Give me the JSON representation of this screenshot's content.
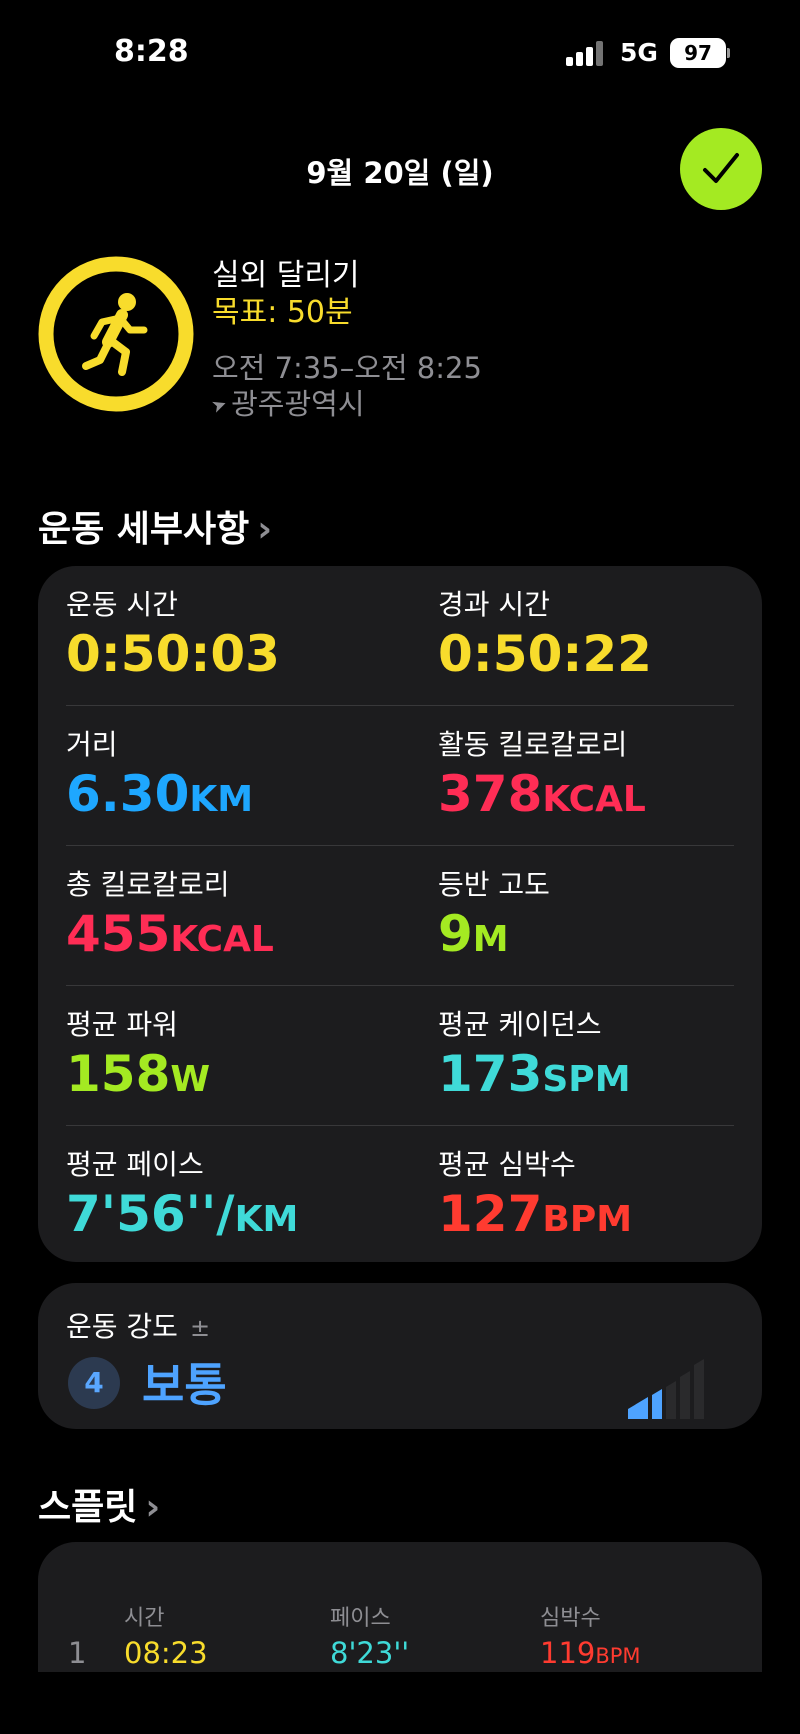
{
  "status_bar": {
    "time": "8:28",
    "network": "5G",
    "battery": "97"
  },
  "header": {
    "date": "9월 20일 (일)"
  },
  "workout": {
    "name": "실외 달리기",
    "goal": "목표: 50분",
    "time_range": "오전 7:35–오전 8:25",
    "location": "광주광역시",
    "icon": "running-figure-icon",
    "ring_color": "#f8dc2c"
  },
  "details": {
    "title": "운동 세부사항",
    "metrics": [
      {
        "label": "운동 시간",
        "value": "0:50:03",
        "unit": "",
        "color": "#f8dc2c"
      },
      {
        "label": "경과 시간",
        "value": "0:50:22",
        "unit": "",
        "color": "#f8dc2c"
      },
      {
        "label": "거리",
        "value": "6.30",
        "unit": "KM",
        "color": "#1ea7ff"
      },
      {
        "label": "활동 킬로칼로리",
        "value": "378",
        "unit": "KCAL",
        "color": "#ff2d55"
      },
      {
        "label": "총 킬로칼로리",
        "value": "455",
        "unit": "KCAL",
        "color": "#ff2d55"
      },
      {
        "label": "등반 고도",
        "value": "9",
        "unit": "M",
        "color": "#a4ea22"
      },
      {
        "label": "평균 파워",
        "value": "158",
        "unit": "W",
        "color": "#a4ea22"
      },
      {
        "label": "평균 케이던스",
        "value": "173",
        "unit": "SPM",
        "color": "#3fdad8"
      },
      {
        "label": "평균 페이스",
        "value": "7'56''/",
        "unit": "KM",
        "color": "#3fdad8"
      },
      {
        "label": "평균 심박수",
        "value": "127",
        "unit": "BPM",
        "color": "#ff3b30"
      }
    ]
  },
  "effort": {
    "label": "운동 강도",
    "adjust_symbol": "±",
    "level_number": "4",
    "level_text": "보통",
    "bars_filled_fraction": 0.4
  },
  "splits": {
    "title": "스플릿",
    "headers": [
      "시간",
      "페이스",
      "심박수"
    ],
    "rows": [
      {
        "index": "1",
        "time": "08:23",
        "pace": "8'23''",
        "hr": "119",
        "hr_unit": "BPM"
      }
    ]
  }
}
